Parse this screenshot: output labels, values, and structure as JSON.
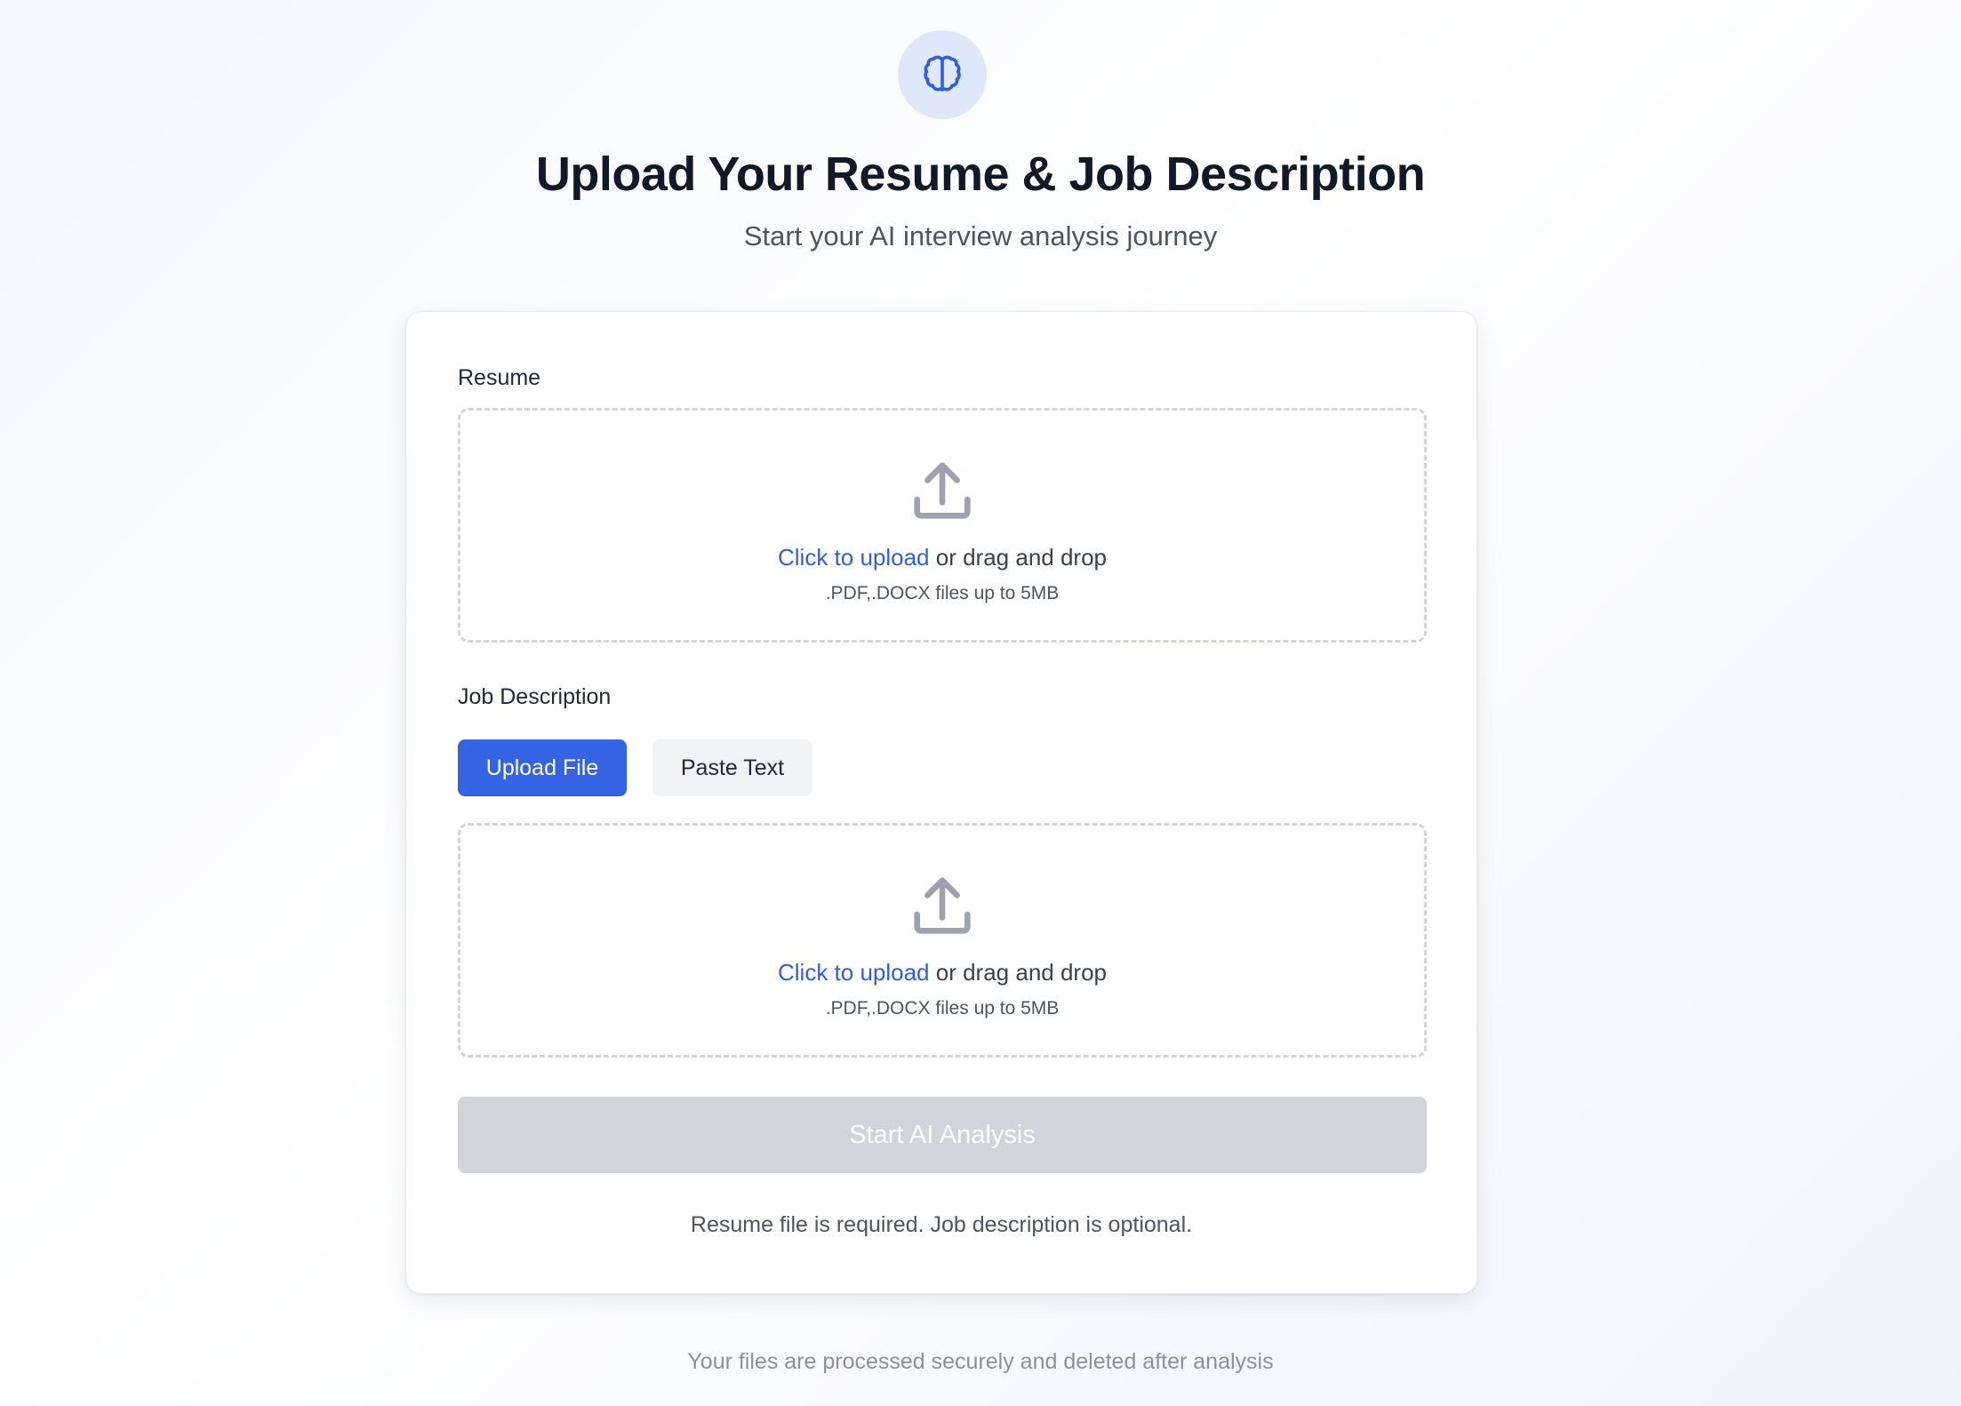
{
  "header": {
    "logo_icon": "brain-icon",
    "title": "Upload Your Resume & Job Description",
    "subtitle": "Start your AI interview analysis journey"
  },
  "colors": {
    "accent": "#3563e3",
    "link": "#2f5ee0",
    "disabled": "#d1d5db"
  },
  "resume": {
    "label": "Resume",
    "dropzone": {
      "icon": "upload-icon",
      "link_text": "Click to upload",
      "rest_text": " or drag and drop",
      "hint": ".PDF,.DOCX files up to 5MB"
    }
  },
  "job_description": {
    "label": "Job Description",
    "tabs": [
      {
        "label": "Upload File",
        "active": true
      },
      {
        "label": "Paste Text",
        "active": false
      }
    ],
    "dropzone": {
      "icon": "upload-icon",
      "link_text": "Click to upload",
      "rest_text": " or drag and drop",
      "hint": ".PDF,.DOCX files up to 5MB"
    }
  },
  "actions": {
    "start_label": "Start AI Analysis",
    "start_disabled": true
  },
  "requirement_note": "Resume file is required. Job description is optional.",
  "footer_note": "Your files are processed securely and deleted after analysis"
}
